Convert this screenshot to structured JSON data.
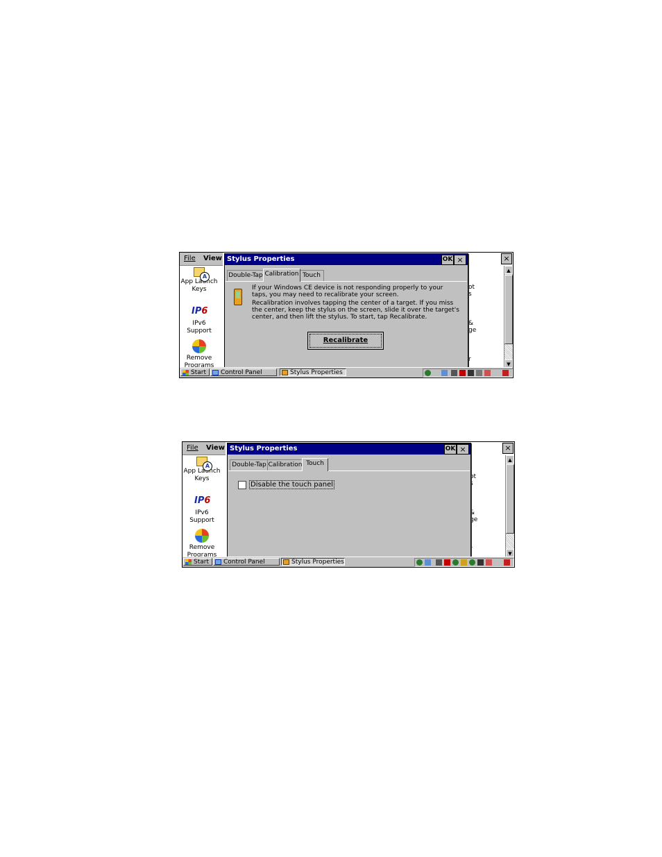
{
  "screenshot1": {
    "menu": {
      "file": "File",
      "view": "View"
    },
    "icons": [
      {
        "label1": "App Launch",
        "label2": "Keys",
        "icon": "app-launch-keys-icon"
      },
      {
        "label1": "IPv6",
        "label2": "Support",
        "icon": "ipv6-icon"
      },
      {
        "label1": "Remove",
        "label2": "Programs",
        "icon": "remove-programs-icon"
      }
    ],
    "right_fragments": [
      "ot",
      "s",
      "&",
      "ge",
      "r"
    ],
    "dialog": {
      "title": "Stylus Properties",
      "ok": "OK",
      "close": "×",
      "tabs": [
        "Double-Tap",
        "Calibration",
        "Touch"
      ],
      "active_tab": "Calibration",
      "para1": "If your Windows CE device is not responding properly to your taps, you may need to recalibrate your screen.",
      "para2": "Recalibration involves tapping the center of a target. If you miss the center, keep the stylus on the screen, slide it over the target's center, and then lift the stylus. To start, tap Recalibrate.",
      "button": "Recalibrate"
    },
    "taskbar": {
      "start": "Start",
      "task1": "Control Panel",
      "task2": "Stylus Properties"
    }
  },
  "screenshot2": {
    "menu": {
      "file": "File",
      "view": "View"
    },
    "icons": [
      {
        "label1": "App Launch",
        "label2": "Keys",
        "icon": "app-launch-keys-icon"
      },
      {
        "label1": "IPv6",
        "label2": "Support",
        "icon": "ipv6-icon"
      },
      {
        "label1": "Remove",
        "label2": "Programs",
        "icon": "remove-programs-icon"
      }
    ],
    "right_fragments": [
      "ot",
      "s",
      "&",
      "ge",
      "r"
    ],
    "dialog": {
      "title": "Stylus Properties",
      "ok": "OK",
      "close": "×",
      "tabs": [
        "Double-Tap",
        "Calibration",
        "Touch"
      ],
      "active_tab": "Touch",
      "checkbox_label": "Disable the touch panel",
      "checkbox_checked": false
    },
    "taskbar": {
      "start": "Start",
      "task1": "Control Panel",
      "task2": "Stylus Properties"
    }
  },
  "window_close": "×",
  "scroll_up": "▲",
  "scroll_down": "▼"
}
